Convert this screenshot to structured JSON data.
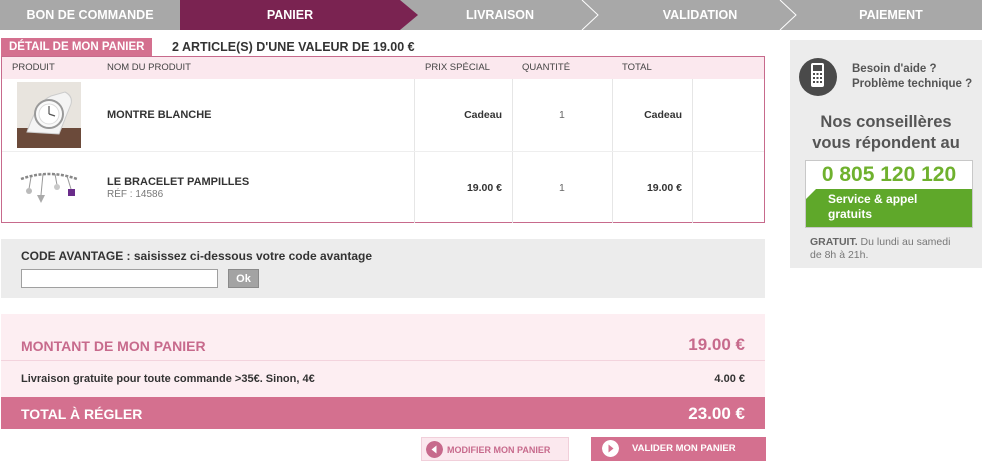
{
  "steps": [
    {
      "label": "BON DE COMMANDE"
    },
    {
      "label": "PANIER"
    },
    {
      "label": "LIVRAISON"
    },
    {
      "label": "VALIDATION"
    },
    {
      "label": "PAIEMENT"
    }
  ],
  "cart": {
    "tag": "DÉTAIL DE MON PANIER",
    "summary": "2 ARTICLE(S) D'UNE VALEUR DE 19.00 €",
    "headers": {
      "product": "PRODUIT",
      "name": "NOM DU PRODUIT",
      "price": "PRIX SPÉCIAL",
      "qty": "QUANTITÉ",
      "total": "TOTAL"
    },
    "items": [
      {
        "name": "MONTRE BLANCHE",
        "ref": "",
        "price": "Cadeau",
        "qty": "1",
        "total": "Cadeau",
        "image_icon": "watch-icon"
      },
      {
        "name": "LE BRACELET PAMPILLES",
        "ref": "RÉF : 14586",
        "price": "19.00 €",
        "qty": "1",
        "total": "19.00 €",
        "image_icon": "bracelet-icon"
      }
    ]
  },
  "promo": {
    "label": "CODE AVANTAGE : saisissez ci-dessous votre code avantage",
    "value": "",
    "button": "Ok"
  },
  "totals": {
    "cart_label": "MONTANT DE MON PANIER",
    "cart_value": "19.00 €",
    "shipping_label": "Livraison gratuite pour toute commande >35€. Sinon, 4€",
    "shipping_value": "4.00 €",
    "total_label": "TOTAL À RÉGLER",
    "total_value": "23.00 €"
  },
  "actions": {
    "modify": "MODIFIER MON PANIER",
    "validate": "VALIDER MON PANIER"
  },
  "help": {
    "q1": "Besoin d'aide ?",
    "q2": "Problème technique ?",
    "line1": "Nos conseillères",
    "line2": "vous répondent au",
    "phone": "0 805 120 120",
    "service1": "Service & appel",
    "service2": "gratuits",
    "foot_strong": "GRATUIT.",
    "foot1": " Du lundi au samedi",
    "foot2": "de 8h à 21h."
  },
  "colors": {
    "accent": "#d4708f",
    "active_step": "#7a2351",
    "step_bg": "#a8a8a8",
    "phone_green": "#5fa82a"
  }
}
